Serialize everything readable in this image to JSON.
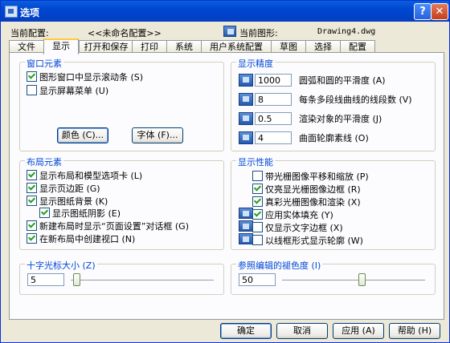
{
  "window": {
    "title": "选项",
    "help_glyph": "?",
    "close_glyph": "✕"
  },
  "config": {
    "current_config_label": "当前配置:",
    "current_config_value": "<<未命名配置>>",
    "current_drawing_label": "当前图形:",
    "current_drawing_value": "Drawing4.dwg"
  },
  "tabs": [
    "文件",
    "显示",
    "打开和保存",
    "打印",
    "系统",
    "用户系统配置",
    "草图",
    "选择",
    "配置"
  ],
  "active_tab": "显示",
  "window_elements": {
    "title": "窗口元素",
    "checks": [
      {
        "label": "图形窗口中显示滚动条 (S)",
        "checked": true
      },
      {
        "label": "显示屏幕菜单 (U)",
        "checked": false
      }
    ],
    "colors_button": "颜色 (C)...",
    "fonts_button": "字体 (F)..."
  },
  "display_resolution": {
    "title": "显示精度",
    "rows": [
      {
        "value": "1000",
        "label": "圆弧和圆的平滑度 (A)"
      },
      {
        "value": "8",
        "label": "每条多段线曲线的线段数 (V)"
      },
      {
        "value": "0.5",
        "label": "渲染对象的平滑度 (J)"
      },
      {
        "value": "4",
        "label": "曲面轮廓素线 (O)"
      }
    ]
  },
  "layout_elements": {
    "title": "布局元素",
    "checks": [
      {
        "label": "显示布局和模型选项卡 (L)",
        "checked": true
      },
      {
        "label": "显示页边距 (G)",
        "checked": true
      },
      {
        "label": "显示图纸背景 (K)",
        "checked": true
      },
      {
        "label": "显示图纸阴影 (E)",
        "checked": true
      },
      {
        "label": "新建布局时显示“页面设置”对话框 (G)",
        "checked": true
      },
      {
        "label": "在新布局中创建视口 (N)",
        "checked": true
      }
    ]
  },
  "display_performance": {
    "title": "显示性能",
    "checks": [
      {
        "label": "带光栅图像平移和缩放 (P)",
        "checked": false
      },
      {
        "label": "仅亮显光栅图像边框 (R)",
        "checked": true
      },
      {
        "label": "真彩光栅图像和渲染 (X)",
        "checked": true
      },
      {
        "label": "应用实体填充 (Y)",
        "checked": true
      },
      {
        "label": "仅显示文字边框 (X)",
        "checked": false
      },
      {
        "label": "以线框形式显示轮廓 (W)",
        "checked": false
      }
    ]
  },
  "crosshair": {
    "title": "十字光标大小 (Z)",
    "value": "5",
    "level": 5
  },
  "xref_fade": {
    "title": "参照编辑的褪色度 (I)",
    "value": "50",
    "level": 50
  },
  "buttons": {
    "ok": "确定",
    "cancel": "取消",
    "apply": "应用 (A)",
    "help": "帮助 (H)"
  }
}
